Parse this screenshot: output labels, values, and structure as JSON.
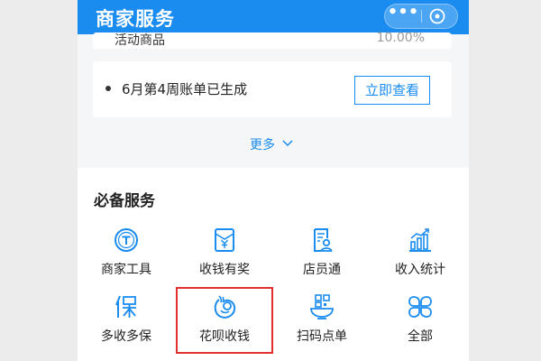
{
  "header": {
    "title": "商家服务",
    "more_glyph": "•••"
  },
  "card_top": {
    "left_text": "活动商品",
    "right_text": "10.00%"
  },
  "notice": {
    "text": "6月第4周账单已生成",
    "button_label": "立即查看"
  },
  "more_link": {
    "label": "更多"
  },
  "services": {
    "title": "必备服务",
    "items": [
      {
        "label": "商家工具",
        "icon": "coin-t-icon"
      },
      {
        "label": "收钱有奖",
        "icon": "red-envelope-yuan-icon"
      },
      {
        "label": "店员通",
        "icon": "staff-card-icon"
      },
      {
        "label": "收入统计",
        "icon": "bar-chart-icon"
      },
      {
        "label": "多收多保",
        "icon": "shield-bao-icon"
      },
      {
        "label": "花呗收钱",
        "icon": "huabei-icon"
      },
      {
        "label": "扫码点单",
        "icon": "qr-bowl-icon"
      },
      {
        "label": "全部",
        "icon": "grid-petals-icon"
      }
    ]
  },
  "colors": {
    "accent": "#1a8cf0",
    "highlight": "#e0302f"
  }
}
